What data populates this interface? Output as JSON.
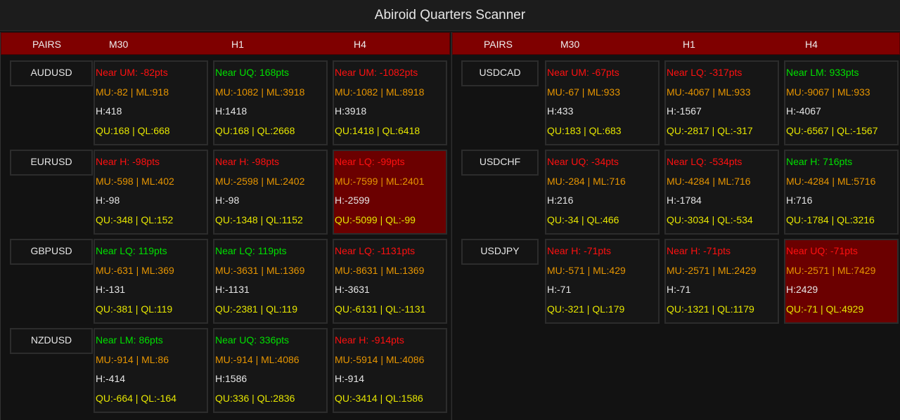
{
  "title": "Abiroid Quarters Scanner",
  "colors": {
    "header_bg": "#7f0000",
    "highlight_bg": "#6b0000",
    "near_negative": "#ff1010",
    "near_positive": "#00e000",
    "mu_ml": "#e69500",
    "h": "#e6e6e6",
    "qu_ql": "#e6e600"
  },
  "panels": [
    {
      "headers": {
        "pairs": "PAIRS",
        "tf": [
          "M30",
          "H1",
          "H4"
        ]
      },
      "rows": [
        {
          "pair": "AUDUSD",
          "cells": [
            {
              "near": "Near UM: -82pts",
              "status": "red",
              "mu_ml": "MU:-82 | ML:918",
              "h": "H:418",
              "qu_ql": "QU:168 | QL:668",
              "highlight": false
            },
            {
              "near": "Near UQ: 168pts",
              "status": "green",
              "mu_ml": "MU:-1082 | ML:3918",
              "h": "H:1418",
              "qu_ql": "QU:168 | QL:2668",
              "highlight": false
            },
            {
              "near": "Near UM: -1082pts",
              "status": "red",
              "mu_ml": "MU:-1082 | ML:8918",
              "h": "H:3918",
              "qu_ql": "QU:1418 | QL:6418",
              "highlight": false
            }
          ]
        },
        {
          "pair": "EURUSD",
          "cells": [
            {
              "near": "Near H: -98pts",
              "status": "red",
              "mu_ml": "MU:-598 | ML:402",
              "h": "H:-98",
              "qu_ql": "QU:-348 | QL:152",
              "highlight": false
            },
            {
              "near": "Near H: -98pts",
              "status": "red",
              "mu_ml": "MU:-2598 | ML:2402",
              "h": "H:-98",
              "qu_ql": "QU:-1348 | QL:1152",
              "highlight": false
            },
            {
              "near": "Near LQ: -99pts",
              "status": "red",
              "mu_ml": "MU:-7599 | ML:2401",
              "h": "H:-2599",
              "qu_ql": "QU:-5099 | QL:-99",
              "highlight": true
            }
          ]
        },
        {
          "pair": "GBPUSD",
          "cells": [
            {
              "near": "Near LQ: 119pts",
              "status": "green",
              "mu_ml": "MU:-631 | ML:369",
              "h": "H:-131",
              "qu_ql": "QU:-381 | QL:119",
              "highlight": false
            },
            {
              "near": "Near LQ: 119pts",
              "status": "green",
              "mu_ml": "MU:-3631 | ML:1369",
              "h": "H:-1131",
              "qu_ql": "QU:-2381 | QL:119",
              "highlight": false
            },
            {
              "near": "Near LQ: -1131pts",
              "status": "red",
              "mu_ml": "MU:-8631 | ML:1369",
              "h": "H:-3631",
              "qu_ql": "QU:-6131 | QL:-1131",
              "highlight": false
            }
          ]
        },
        {
          "pair": "NZDUSD",
          "cells": [
            {
              "near": "Near LM: 86pts",
              "status": "green",
              "mu_ml": "MU:-914 | ML:86",
              "h": "H:-414",
              "qu_ql": "QU:-664 | QL:-164",
              "highlight": false
            },
            {
              "near": "Near UQ: 336pts",
              "status": "green",
              "mu_ml": "MU:-914 | ML:4086",
              "h": "H:1586",
              "qu_ql": "QU:336 | QL:2836",
              "highlight": false
            },
            {
              "near": "Near H: -914pts",
              "status": "red",
              "mu_ml": "MU:-5914 | ML:4086",
              "h": "H:-914",
              "qu_ql": "QU:-3414 | QL:1586",
              "highlight": false
            }
          ]
        }
      ]
    },
    {
      "headers": {
        "pairs": "PAIRS",
        "tf": [
          "M30",
          "H1",
          "H4"
        ]
      },
      "rows": [
        {
          "pair": "USDCAD",
          "cells": [
            {
              "near": "Near UM: -67pts",
              "status": "red",
              "mu_ml": "MU:-67 | ML:933",
              "h": "H:433",
              "qu_ql": "QU:183 | QL:683",
              "highlight": false
            },
            {
              "near": "Near LQ: -317pts",
              "status": "red",
              "mu_ml": "MU:-4067 | ML:933",
              "h": "H:-1567",
              "qu_ql": "QU:-2817 | QL:-317",
              "highlight": false
            },
            {
              "near": "Near LM: 933pts",
              "status": "green",
              "mu_ml": "MU:-9067 | ML:933",
              "h": "H:-4067",
              "qu_ql": "QU:-6567 | QL:-1567",
              "highlight": false
            }
          ]
        },
        {
          "pair": "USDCHF",
          "cells": [
            {
              "near": "Near UQ: -34pts",
              "status": "red",
              "mu_ml": "MU:-284 | ML:716",
              "h": "H:216",
              "qu_ql": "QU:-34 | QL:466",
              "highlight": false
            },
            {
              "near": "Near LQ: -534pts",
              "status": "red",
              "mu_ml": "MU:-4284 | ML:716",
              "h": "H:-1784",
              "qu_ql": "QU:-3034 | QL:-534",
              "highlight": false
            },
            {
              "near": "Near H: 716pts",
              "status": "green",
              "mu_ml": "MU:-4284 | ML:5716",
              "h": "H:716",
              "qu_ql": "QU:-1784 | QL:3216",
              "highlight": false
            }
          ]
        },
        {
          "pair": "USDJPY",
          "cells": [
            {
              "near": "Near H: -71pts",
              "status": "red",
              "mu_ml": "MU:-571 | ML:429",
              "h": "H:-71",
              "qu_ql": "QU:-321 | QL:179",
              "highlight": false
            },
            {
              "near": "Near H: -71pts",
              "status": "red",
              "mu_ml": "MU:-2571 | ML:2429",
              "h": "H:-71",
              "qu_ql": "QU:-1321 | QL:1179",
              "highlight": false
            },
            {
              "near": "Near UQ: -71pts",
              "status": "red",
              "mu_ml": "MU:-2571 | ML:7429",
              "h": "H:2429",
              "qu_ql": "QU:-71 | QL:4929",
              "highlight": true
            }
          ]
        }
      ]
    }
  ]
}
